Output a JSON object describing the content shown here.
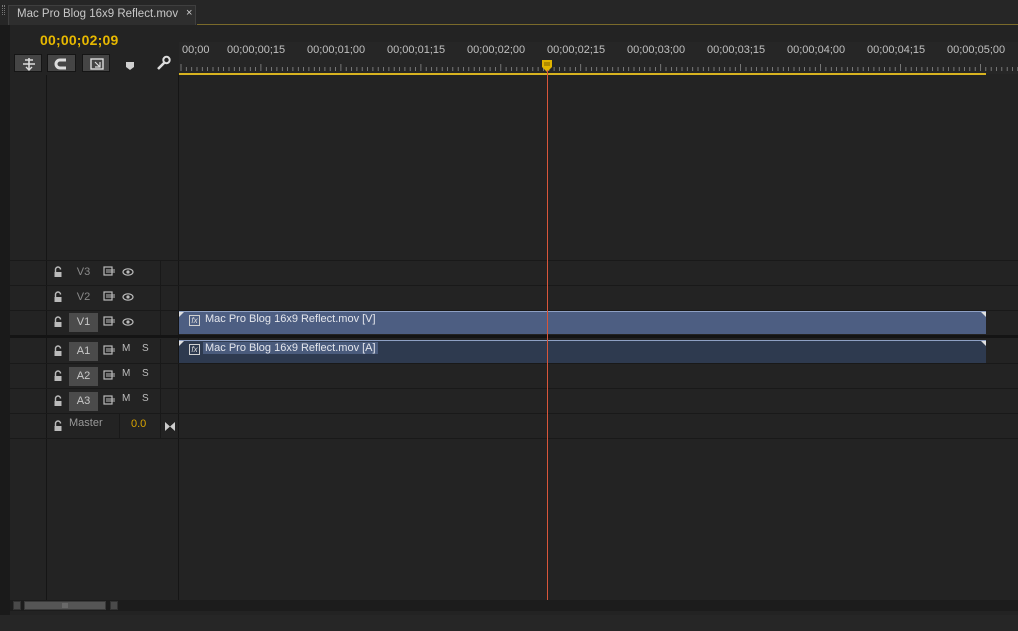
{
  "tab": {
    "title": "Mac Pro Blog 16x9 Reflect.mov",
    "close_glyph": "×"
  },
  "timecode": "00;00;02;09",
  "toolbar": {
    "tools": [
      {
        "name": "snap-nested-icon",
        "interactable": true
      },
      {
        "name": "magnet-snap-icon",
        "interactable": true
      },
      {
        "name": "linked-selection-icon",
        "interactable": true
      },
      {
        "name": "add-marker-icon",
        "interactable": true
      },
      {
        "name": "wrench-settings-icon",
        "interactable": true
      }
    ]
  },
  "ruler": {
    "labels": [
      "00;00",
      "00;00;00;15",
      "00;00;01;00",
      "00;00;01;15",
      "00;00;02;00",
      "00;00;02;15",
      "00;00;03;00",
      "00;00;03;15",
      "00;00;04;00",
      "00;00;04;15",
      "00;00;05;00"
    ]
  },
  "tracks": {
    "video": [
      {
        "name": "V3",
        "active": false
      },
      {
        "name": "V2",
        "active": false
      },
      {
        "name": "V1",
        "active": true
      }
    ],
    "audio": [
      {
        "name": "A1",
        "active": true,
        "mute": "M",
        "solo": "S"
      },
      {
        "name": "A2",
        "active": true,
        "mute": "M",
        "solo": "S"
      },
      {
        "name": "A3",
        "active": true,
        "mute": "M",
        "solo": "S"
      }
    ],
    "master": {
      "label": "Master",
      "volume": "0.0"
    }
  },
  "clips": {
    "video": {
      "name": "Mac Pro Blog 16x9 Reflect.mov [V]",
      "fx": "fx"
    },
    "audio": {
      "name": "Mac Pro Blog 16x9 Reflect.mov [A]",
      "fx": "fx"
    }
  },
  "colors": {
    "timecode": "#e8b900",
    "playhead": "#d8553a",
    "video_clip": "#4d5e82",
    "audio_clip": "#2e3a4f"
  }
}
